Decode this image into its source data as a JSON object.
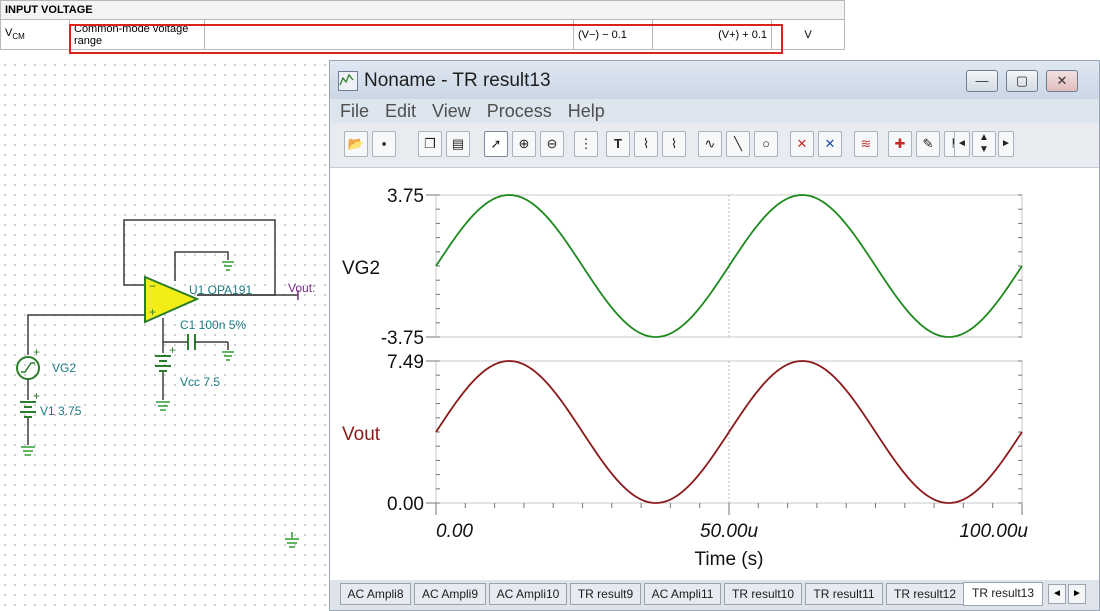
{
  "datasheet": {
    "section": "INPUT VOLTAGE",
    "symbol": "V",
    "symbol_sub": "CM",
    "parameter": "Common-mode voltage range",
    "min": "(V−) − 0.1",
    "max": "(V+) + 0.1",
    "unit": "V"
  },
  "schematic": {
    "opamp_label": "U1 OPA191",
    "out_label": "Vout:",
    "cap_label": "C1 100n 5%",
    "vcc_label": "Vcc 7.5",
    "vg_label": "VG2",
    "v1_label": "V1 3.75",
    "plus": "+",
    "minus": "−"
  },
  "window": {
    "title": "Noname - TR result13",
    "buttons": {
      "minimize": "—",
      "maximize": "▢",
      "close": "✕"
    },
    "menu": [
      "File",
      "Edit",
      "View",
      "Process",
      "Help"
    ],
    "toolbar_icons": [
      "open-icon",
      "save-icon",
      "copy-icon",
      "paste-icon",
      "pointer-icon",
      "zoom-in-icon",
      "zoom-100-icon",
      "grid-icon",
      "text-icon",
      "cursor-a-icon",
      "cursor-b-icon",
      "curve-icon",
      "line-icon",
      "circle-icon",
      "marker-a-icon",
      "marker-b-icon",
      "series-icon",
      "pick-color-icon",
      "eyedropper-icon",
      "flag-icon",
      "nav-left-icon",
      "nav-updown-icon",
      "nav-right-icon"
    ]
  },
  "chart_data": {
    "type": "line",
    "xlabel": "Time (s)",
    "x_ticks": [
      "0.00",
      "50.00u",
      "100.00u"
    ],
    "x_range": [
      0,
      100
    ],
    "x_units": "us",
    "subplots": [
      {
        "name": "VG2",
        "y_ticks": [
          "3.75",
          "-3.75"
        ],
        "ylim": [
          -3.75,
          3.75
        ],
        "color": "#1e8a1e",
        "waveform": "sine",
        "amplitude": 3.75,
        "offset": 0,
        "period_us": 50,
        "phase_at_0": 0
      },
      {
        "name": "Vout",
        "y_ticks": [
          "7.49",
          "0.00"
        ],
        "ylim": [
          0,
          7.49
        ],
        "color": "#8b1a1a",
        "waveform": "sine",
        "amplitude": 3.745,
        "offset": 3.745,
        "period_us": 50,
        "phase_at_0": 0
      }
    ]
  },
  "tabs": [
    "AC Ampli8",
    "AC Ampli9",
    "AC Ampli10",
    "TR result9",
    "AC Ampli11",
    "TR result10",
    "TR result11",
    "TR result12",
    "TR result13"
  ],
  "active_tab": "TR result13",
  "tab_arrows": [
    "◄",
    "►"
  ]
}
